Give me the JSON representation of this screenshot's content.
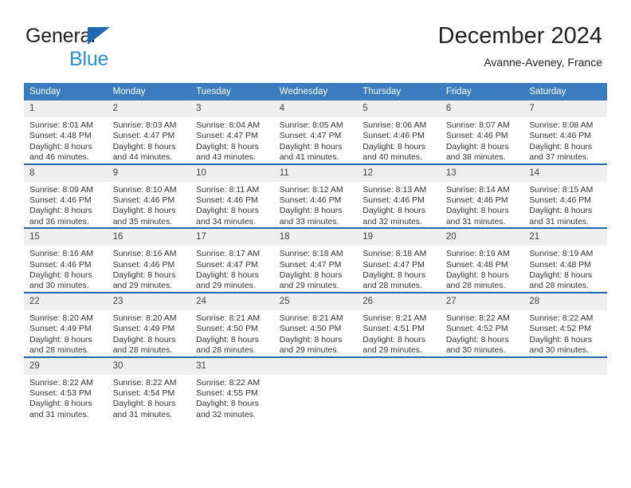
{
  "brand": {
    "name_part1": "General",
    "name_part2": "Blue",
    "logo_icon": "triangle-logo-icon"
  },
  "header": {
    "title": "December 2024",
    "location": "Avanne-Aveney, France"
  },
  "colors": {
    "header_blue": "#3a7cbd",
    "row_divider_blue": "#1f68b0",
    "daynum_band": "#efefef",
    "brand_blue": "#2b8fd6",
    "logo_blue": "#1f68b0"
  },
  "weekday_headers": [
    "Sunday",
    "Monday",
    "Tuesday",
    "Wednesday",
    "Thursday",
    "Friday",
    "Saturday"
  ],
  "weeks": [
    [
      {
        "day": "1",
        "sunrise": "Sunrise: 8:01 AM",
        "sunset": "Sunset: 4:48 PM",
        "daylight_line1": "Daylight: 8 hours",
        "daylight_line2": "and 46 minutes."
      },
      {
        "day": "2",
        "sunrise": "Sunrise: 8:03 AM",
        "sunset": "Sunset: 4:47 PM",
        "daylight_line1": "Daylight: 8 hours",
        "daylight_line2": "and 44 minutes."
      },
      {
        "day": "3",
        "sunrise": "Sunrise: 8:04 AM",
        "sunset": "Sunset: 4:47 PM",
        "daylight_line1": "Daylight: 8 hours",
        "daylight_line2": "and 43 minutes."
      },
      {
        "day": "4",
        "sunrise": "Sunrise: 8:05 AM",
        "sunset": "Sunset: 4:47 PM",
        "daylight_line1": "Daylight: 8 hours",
        "daylight_line2": "and 41 minutes."
      },
      {
        "day": "5",
        "sunrise": "Sunrise: 8:06 AM",
        "sunset": "Sunset: 4:46 PM",
        "daylight_line1": "Daylight: 8 hours",
        "daylight_line2": "and 40 minutes."
      },
      {
        "day": "6",
        "sunrise": "Sunrise: 8:07 AM",
        "sunset": "Sunset: 4:46 PM",
        "daylight_line1": "Daylight: 8 hours",
        "daylight_line2": "and 38 minutes."
      },
      {
        "day": "7",
        "sunrise": "Sunrise: 8:08 AM",
        "sunset": "Sunset: 4:46 PM",
        "daylight_line1": "Daylight: 8 hours",
        "daylight_line2": "and 37 minutes."
      }
    ],
    [
      {
        "day": "8",
        "sunrise": "Sunrise: 8:09 AM",
        "sunset": "Sunset: 4:46 PM",
        "daylight_line1": "Daylight: 8 hours",
        "daylight_line2": "and 36 minutes."
      },
      {
        "day": "9",
        "sunrise": "Sunrise: 8:10 AM",
        "sunset": "Sunset: 4:46 PM",
        "daylight_line1": "Daylight: 8 hours",
        "daylight_line2": "and 35 minutes."
      },
      {
        "day": "10",
        "sunrise": "Sunrise: 8:11 AM",
        "sunset": "Sunset: 4:46 PM",
        "daylight_line1": "Daylight: 8 hours",
        "daylight_line2": "and 34 minutes."
      },
      {
        "day": "11",
        "sunrise": "Sunrise: 8:12 AM",
        "sunset": "Sunset: 4:46 PM",
        "daylight_line1": "Daylight: 8 hours",
        "daylight_line2": "and 33 minutes."
      },
      {
        "day": "12",
        "sunrise": "Sunrise: 8:13 AM",
        "sunset": "Sunset: 4:46 PM",
        "daylight_line1": "Daylight: 8 hours",
        "daylight_line2": "and 32 minutes."
      },
      {
        "day": "13",
        "sunrise": "Sunrise: 8:14 AM",
        "sunset": "Sunset: 4:46 PM",
        "daylight_line1": "Daylight: 8 hours",
        "daylight_line2": "and 31 minutes."
      },
      {
        "day": "14",
        "sunrise": "Sunrise: 8:15 AM",
        "sunset": "Sunset: 4:46 PM",
        "daylight_line1": "Daylight: 8 hours",
        "daylight_line2": "and 31 minutes."
      }
    ],
    [
      {
        "day": "15",
        "sunrise": "Sunrise: 8:16 AM",
        "sunset": "Sunset: 4:46 PM",
        "daylight_line1": "Daylight: 8 hours",
        "daylight_line2": "and 30 minutes."
      },
      {
        "day": "16",
        "sunrise": "Sunrise: 8:16 AM",
        "sunset": "Sunset: 4:46 PM",
        "daylight_line1": "Daylight: 8 hours",
        "daylight_line2": "and 29 minutes."
      },
      {
        "day": "17",
        "sunrise": "Sunrise: 8:17 AM",
        "sunset": "Sunset: 4:47 PM",
        "daylight_line1": "Daylight: 8 hours",
        "daylight_line2": "and 29 minutes."
      },
      {
        "day": "18",
        "sunrise": "Sunrise: 8:18 AM",
        "sunset": "Sunset: 4:47 PM",
        "daylight_line1": "Daylight: 8 hours",
        "daylight_line2": "and 29 minutes."
      },
      {
        "day": "19",
        "sunrise": "Sunrise: 8:18 AM",
        "sunset": "Sunset: 4:47 PM",
        "daylight_line1": "Daylight: 8 hours",
        "daylight_line2": "and 28 minutes."
      },
      {
        "day": "20",
        "sunrise": "Sunrise: 8:19 AM",
        "sunset": "Sunset: 4:48 PM",
        "daylight_line1": "Daylight: 8 hours",
        "daylight_line2": "and 28 minutes."
      },
      {
        "day": "21",
        "sunrise": "Sunrise: 8:19 AM",
        "sunset": "Sunset: 4:48 PM",
        "daylight_line1": "Daylight: 8 hours",
        "daylight_line2": "and 28 minutes."
      }
    ],
    [
      {
        "day": "22",
        "sunrise": "Sunrise: 8:20 AM",
        "sunset": "Sunset: 4:49 PM",
        "daylight_line1": "Daylight: 8 hours",
        "daylight_line2": "and 28 minutes."
      },
      {
        "day": "23",
        "sunrise": "Sunrise: 8:20 AM",
        "sunset": "Sunset: 4:49 PM",
        "daylight_line1": "Daylight: 8 hours",
        "daylight_line2": "and 28 minutes."
      },
      {
        "day": "24",
        "sunrise": "Sunrise: 8:21 AM",
        "sunset": "Sunset: 4:50 PM",
        "daylight_line1": "Daylight: 8 hours",
        "daylight_line2": "and 28 minutes."
      },
      {
        "day": "25",
        "sunrise": "Sunrise: 8:21 AM",
        "sunset": "Sunset: 4:50 PM",
        "daylight_line1": "Daylight: 8 hours",
        "daylight_line2": "and 29 minutes."
      },
      {
        "day": "26",
        "sunrise": "Sunrise: 8:21 AM",
        "sunset": "Sunset: 4:51 PM",
        "daylight_line1": "Daylight: 8 hours",
        "daylight_line2": "and 29 minutes."
      },
      {
        "day": "27",
        "sunrise": "Sunrise: 8:22 AM",
        "sunset": "Sunset: 4:52 PM",
        "daylight_line1": "Daylight: 8 hours",
        "daylight_line2": "and 30 minutes."
      },
      {
        "day": "28",
        "sunrise": "Sunrise: 8:22 AM",
        "sunset": "Sunset: 4:52 PM",
        "daylight_line1": "Daylight: 8 hours",
        "daylight_line2": "and 30 minutes."
      }
    ],
    [
      {
        "day": "29",
        "sunrise": "Sunrise: 8:22 AM",
        "sunset": "Sunset: 4:53 PM",
        "daylight_line1": "Daylight: 8 hours",
        "daylight_line2": "and 31 minutes."
      },
      {
        "day": "30",
        "sunrise": "Sunrise: 8:22 AM",
        "sunset": "Sunset: 4:54 PM",
        "daylight_line1": "Daylight: 8 hours",
        "daylight_line2": "and 31 minutes."
      },
      {
        "day": "31",
        "sunrise": "Sunrise: 8:22 AM",
        "sunset": "Sunset: 4:55 PM",
        "daylight_line1": "Daylight: 8 hours",
        "daylight_line2": "and 32 minutes."
      },
      {
        "day": "",
        "sunrise": "",
        "sunset": "",
        "daylight_line1": "",
        "daylight_line2": ""
      },
      {
        "day": "",
        "sunrise": "",
        "sunset": "",
        "daylight_line1": "",
        "daylight_line2": ""
      },
      {
        "day": "",
        "sunrise": "",
        "sunset": "",
        "daylight_line1": "",
        "daylight_line2": ""
      },
      {
        "day": "",
        "sunrise": "",
        "sunset": "",
        "daylight_line1": "",
        "daylight_line2": ""
      }
    ]
  ]
}
